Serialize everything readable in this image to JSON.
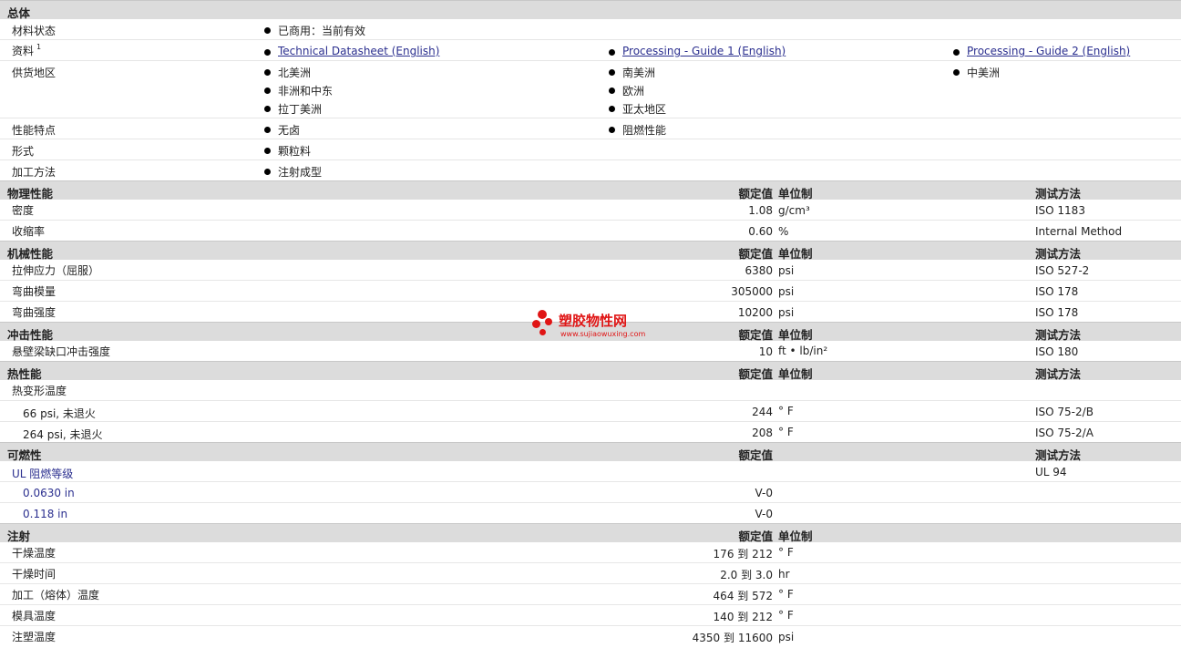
{
  "general": {
    "title": "总体",
    "material_status": {
      "label": "材料状态",
      "value": "已商用：当前有效"
    },
    "docs": {
      "label": "资料",
      "sup": "1",
      "links": [
        "Technical Datasheet (English)",
        "Processing - Guide 1 (English)",
        "Processing - Guide 2 (English)"
      ]
    },
    "regions": {
      "label": "供货地区",
      "items": [
        "北美洲",
        "南美洲",
        "中美洲",
        "非洲和中东",
        "欧洲",
        "拉丁美洲",
        "亚太地区"
      ]
    },
    "features": {
      "label": "性能特点",
      "items": [
        "无卤",
        "阻燃性能"
      ]
    },
    "form": {
      "label": "形式",
      "items": [
        "颗粒料"
      ]
    },
    "processing": {
      "label": "加工方法",
      "items": [
        "注射成型"
      ]
    }
  },
  "headers": {
    "rated": "额定值",
    "unit": "单位制",
    "test": "测试方法"
  },
  "physical": {
    "title": "物理性能",
    "rows": [
      {
        "label": "密度",
        "value": "1.08",
        "unit": "g/cm³",
        "test": "ISO 1183"
      },
      {
        "label": "收缩率",
        "value": "0.60",
        "unit": "%",
        "test": "Internal Method"
      }
    ]
  },
  "mechanical": {
    "title": "机械性能",
    "rows": [
      {
        "label": "拉伸应力（屈服）",
        "value": "6380",
        "unit": "psi",
        "test": "ISO 527-2"
      },
      {
        "label": "弯曲模量",
        "value": "305000",
        "unit": "psi",
        "test": "ISO 178"
      },
      {
        "label": "弯曲强度",
        "value": "10200",
        "unit": "psi",
        "test": "ISO 178"
      }
    ]
  },
  "impact": {
    "title": "冲击性能",
    "rows": [
      {
        "label": "悬壁梁缺口冲击强度",
        "value": "10",
        "unit": "ft • lb/in²",
        "test": "ISO 180"
      }
    ]
  },
  "thermal": {
    "title": "热性能",
    "group_label": "热变形温度",
    "rows": [
      {
        "label": "66 psi, 未退火",
        "value": "244",
        "unit": "° F",
        "test": "ISO 75-2/B"
      },
      {
        "label": "264 psi, 未退火",
        "value": "208",
        "unit": "° F",
        "test": "ISO 75-2/A"
      }
    ]
  },
  "flammability": {
    "title": "可燃性",
    "group_label": "UL 阻燃等级",
    "group_test": "UL 94",
    "rows": [
      {
        "label": "0.0630 in",
        "value": "V-0"
      },
      {
        "label": "0.118 in",
        "value": "V-0"
      }
    ]
  },
  "injection": {
    "title": "注射",
    "rows": [
      {
        "label": "干燥温度",
        "value": "176 到  212",
        "unit": "° F"
      },
      {
        "label": "干燥时间",
        "value": "2.0 到  3.0",
        "unit": "hr"
      },
      {
        "label": "加工（熔体）温度",
        "value": "464 到  572",
        "unit": "° F"
      },
      {
        "label": "模具温度",
        "value": "140 到  212",
        "unit": "° F"
      },
      {
        "label": "注塑温度",
        "value": "4350 到  11600",
        "unit": "psi"
      }
    ]
  },
  "watermark": {
    "name": "塑胶物性网",
    "url": "www.sujiaowuxing.com",
    "color": "#e01515"
  }
}
